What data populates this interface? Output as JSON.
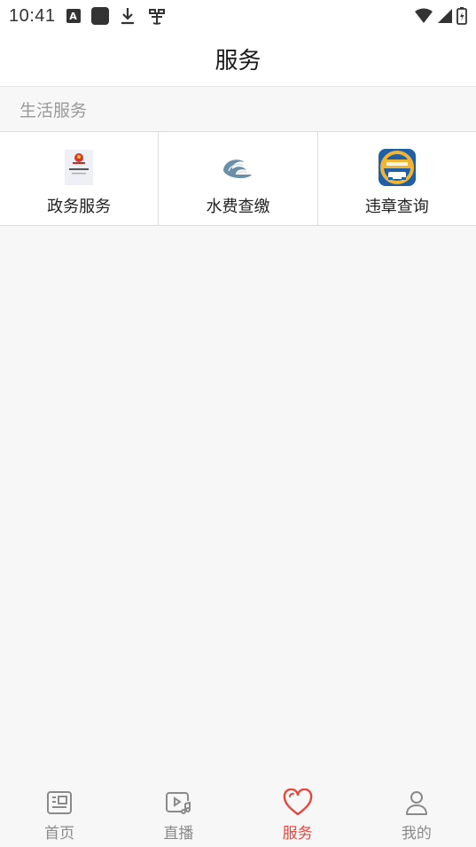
{
  "status_bar": {
    "time": "10:41",
    "icons": [
      "a-badge-icon",
      "square-icon",
      "download-icon",
      "bug-icon"
    ],
    "right_icons": [
      "wifi-icon",
      "signal-icon",
      "battery-charging-icon"
    ]
  },
  "header": {
    "title": "服务"
  },
  "sections": [
    {
      "title": "生活服务",
      "items": [
        {
          "label": "政务服务",
          "icon": "government-emblem-icon"
        },
        {
          "label": "水费查缴",
          "icon": "water-waves-icon"
        },
        {
          "label": "违章查询",
          "icon": "traffic-violation-icon"
        }
      ]
    }
  ],
  "bottom_nav": {
    "active": "服务",
    "accent_color": "#e8463d",
    "items": [
      {
        "label": "首页",
        "icon": "newspaper-icon"
      },
      {
        "label": "直播",
        "icon": "live-video-icon"
      },
      {
        "label": "服务",
        "icon": "heart-icon"
      },
      {
        "label": "我的",
        "icon": "user-icon"
      }
    ]
  }
}
